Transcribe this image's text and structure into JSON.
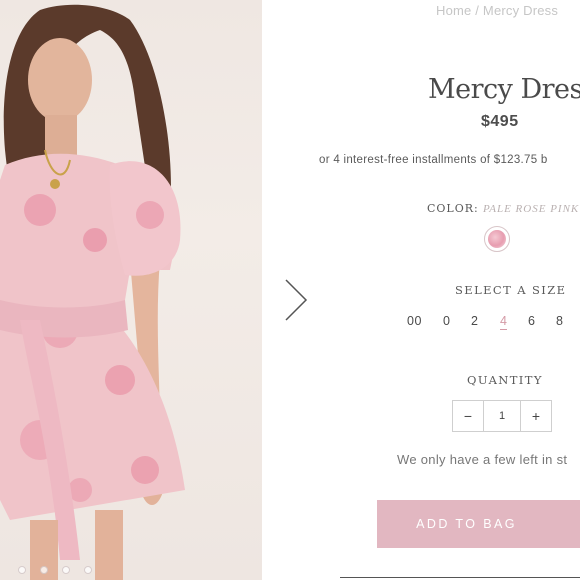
{
  "breadcrumb": {
    "home": "Home",
    "separator": "/",
    "current": "Mercy Dress"
  },
  "product": {
    "title": "Mercy Dress",
    "price": "$495",
    "installments": "or 4 interest-free installments of $123.75 b"
  },
  "color": {
    "label": "COLOR:",
    "value": "PALE ROSE PINK",
    "swatch_color": "#e79db0"
  },
  "size": {
    "label": "SELECT A SIZE",
    "options": [
      "00",
      "0",
      "2",
      "4",
      "6",
      "8"
    ],
    "selected": "4"
  },
  "quantity": {
    "label": "QUANTITY",
    "decrement": "−",
    "value": "1",
    "increment": "+"
  },
  "stock_note": "We only have a few left in st",
  "add_to_bag": "ADD TO BAG",
  "gallery": {
    "image_count": 4,
    "next_icon": "chevron-right-icon"
  },
  "colors": {
    "accent": "#e2b7c1",
    "selected_size": "#d49aa6",
    "text": "#4a4a4a"
  }
}
